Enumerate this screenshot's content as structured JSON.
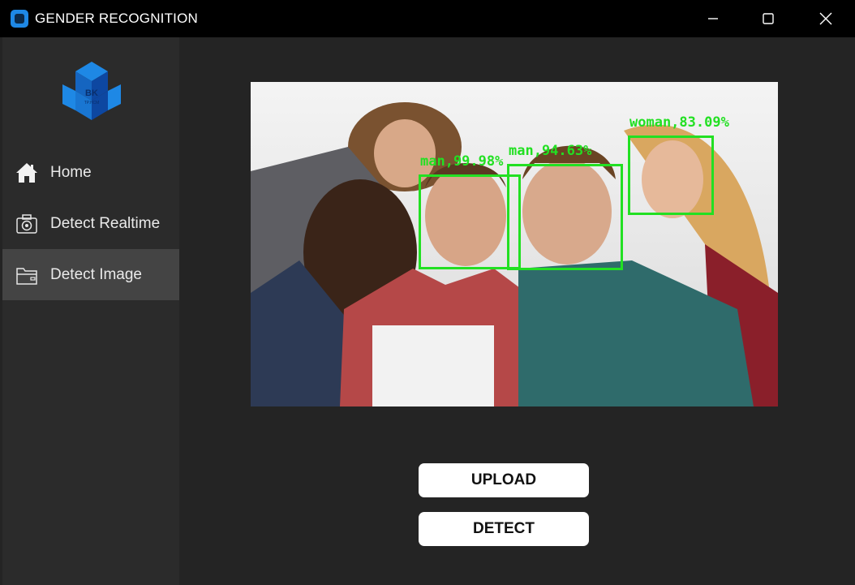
{
  "window": {
    "title": "GENDER RECOGNITION"
  },
  "icons": {
    "app": "app-icon",
    "minimize": "minimize-icon",
    "maximize": "maximize-icon",
    "close": "close-icon",
    "home": "home-icon",
    "realtime": "camera-icon",
    "image": "folder-image-icon",
    "logo": "university-logo"
  },
  "logo": {
    "text_top": "BK",
    "text_bottom": "TP.HCM"
  },
  "sidebar": {
    "items": [
      {
        "label": "Home",
        "active": false
      },
      {
        "label": "Detect Realtime",
        "active": false
      },
      {
        "label": "Detect Image",
        "active": true
      }
    ]
  },
  "detections": [
    {
      "label": "man,99.98%"
    },
    {
      "label": "man,94.63%"
    },
    {
      "label": "woman,83.09%"
    }
  ],
  "actions": {
    "upload_label": "UPLOAD",
    "detect_label": "DETECT"
  },
  "colors": {
    "window_bg": "#242424",
    "sidebar_bg": "#2b2b2b",
    "active_item_bg": "#444444",
    "detection_box": "#22e022",
    "button_bg": "#ffffff"
  }
}
